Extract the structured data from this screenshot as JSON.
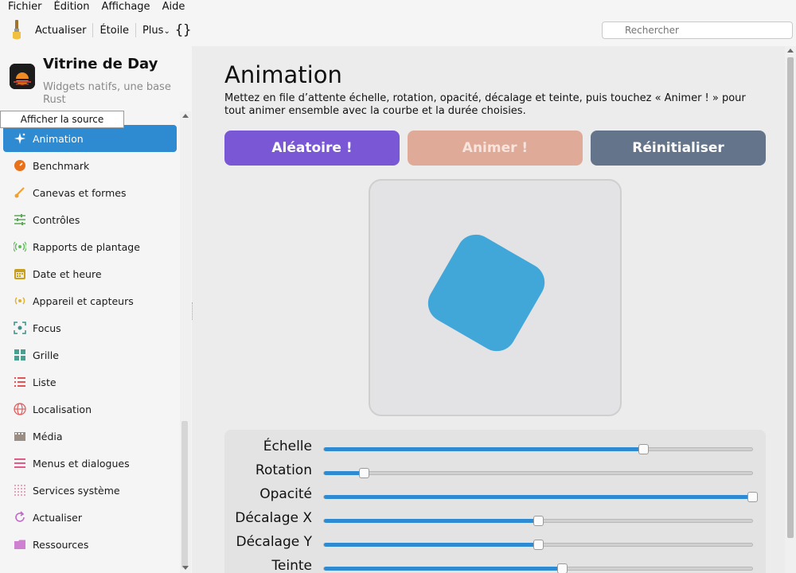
{
  "menubar": [
    "Fichier",
    "Édition",
    "Affichage",
    "Aide"
  ],
  "toolbar": {
    "refresh": "Actualiser",
    "star": "Étoile",
    "more": "Plus",
    "more_caret": "⌄",
    "braces": "{}",
    "search_placeholder": "Rechercher"
  },
  "app": {
    "title": "Vitrine de Day",
    "subtitle": "Widgets natifs, une base Rust",
    "source_button": "Afficher la source"
  },
  "nav": [
    {
      "label": "Animation",
      "icon": "sparkle-icon",
      "color": "#ffffff",
      "active": true
    },
    {
      "label": "Benchmark",
      "icon": "gauge-icon",
      "color": "#e8721c"
    },
    {
      "label": "Canevas et formes",
      "icon": "brush-icon",
      "color": "#f0a030"
    },
    {
      "label": "Contrôles",
      "icon": "sliders-icon",
      "color": "#5aa857"
    },
    {
      "label": "Rapports de plantage",
      "icon": "broadcast-icon",
      "color": "#5fb85a"
    },
    {
      "label": "Date et heure",
      "icon": "calendar-icon",
      "color": "#c8a020"
    },
    {
      "label": "Appareil et capteurs",
      "icon": "sensor-icon",
      "color": "#e0b030"
    },
    {
      "label": "Focus",
      "icon": "focus-icon",
      "color": "#3c8f8a"
    },
    {
      "label": "Grille",
      "icon": "grid-icon",
      "color": "#4aa090"
    },
    {
      "label": "Liste",
      "icon": "list-icon",
      "color": "#e35454"
    },
    {
      "label": "Localisation",
      "icon": "globe-icon",
      "color": "#e06060"
    },
    {
      "label": "Média",
      "icon": "film-icon",
      "color": "#9a8e84"
    },
    {
      "label": "Menus et dialogues",
      "icon": "menu-icon",
      "color": "#e05a8a"
    },
    {
      "label": "Services système",
      "icon": "dots-grid-icon",
      "color": "#e08aa8"
    },
    {
      "label": "Actualiser",
      "icon": "refresh-icon",
      "color": "#c06bc8"
    },
    {
      "label": "Ressources",
      "icon": "folder-icon",
      "color": "#d080d0"
    }
  ],
  "main": {
    "title": "Animation",
    "description": "Mettez en file d’attente échelle, rotation, opacité, décalage et teinte, puis touchez « Animer ! » pour tout animer ensemble avec la courbe et la durée choisies.",
    "buttons": {
      "random": "Aléatoire !",
      "animate": "Animer !",
      "reset": "Réinitialiser"
    },
    "controls": [
      {
        "label": "Échelle",
        "value": 0.745
      },
      {
        "label": "Rotation",
        "value": 0.093
      },
      {
        "label": "Opacité",
        "value": 1.0
      },
      {
        "label": "Décalage X",
        "value": 0.5
      },
      {
        "label": "Décalage Y",
        "value": 0.5
      },
      {
        "label": "Teinte",
        "value": 0.556
      }
    ]
  },
  "colors": {
    "accent": "#2e8bd2",
    "shape": "#41a6d8",
    "random_button": "#7a57d4",
    "animate_button": "#e0aa98",
    "reset_button": "#64748b"
  }
}
